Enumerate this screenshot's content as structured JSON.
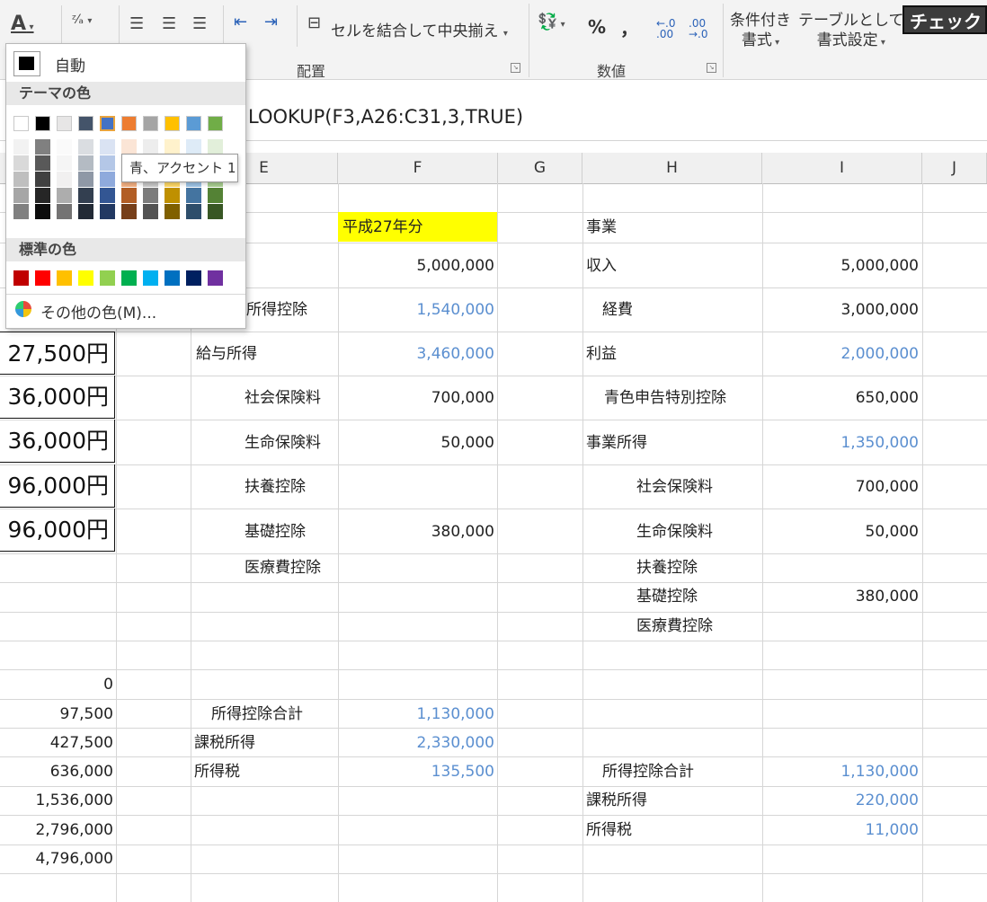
{
  "ribbon": {
    "font_color_icon": "A",
    "align_group_label": "配置",
    "number_group_label": "数値",
    "merge_center_label": "セルを結合して中央揃え",
    "percent_label": "%",
    "comma_label": "，",
    "decrease_decimal_label": "←.0 .00",
    "increase_decimal_label": ".00 →.0",
    "conditional_format_line1": "条件付き",
    "conditional_format_line2": "書式",
    "table_format_line1": "テーブルとして",
    "table_format_line2": "書式設定",
    "cell_style_label": "チェック"
  },
  "formula_bar": {
    "formula": "LOOKUP(F3,A26:C31,3,TRUE)"
  },
  "columns": [
    "E",
    "F",
    "G",
    "H",
    "I",
    "J"
  ],
  "dropdown": {
    "auto_label": "自動",
    "theme_colors_label": "テーマの色",
    "standard_colors_label": "標準の色",
    "more_colors_label": "その他の色(M)...",
    "tooltip": "青、アクセント 1",
    "theme_colors": [
      "#ffffff",
      "#000000",
      "#e7e6e6",
      "#44546a",
      "#4472c4",
      "#ed7d31",
      "#a5a5a5",
      "#ffc000",
      "#5b9bd5",
      "#70ad47"
    ],
    "standard_colors": [
      "#c00000",
      "#ff0000",
      "#ffc000",
      "#ffff00",
      "#92d050",
      "#00b050",
      "#00b0f0",
      "#0070c0",
      "#002060",
      "#7030a0"
    ]
  },
  "left_yen": [
    "27,500円",
    "36,000円",
    "36,000円",
    "96,000円",
    "96,000円"
  ],
  "left_numbers": [
    "0",
    "97,500",
    "427,500",
    "636,000",
    "1,536,000",
    "2,796,000",
    "4,796,000"
  ],
  "cells": {
    "heisei": "平成27年分",
    "f_income": "5,000,000",
    "e_shotoku_kojo": "所得控除",
    "f_shotoku_kojo": "1,540,000",
    "e_kyuyo": "給与所得",
    "f_kyuyo": "3,460,000",
    "e_shakai": "社会保険料",
    "f_shakai": "700,000",
    "e_seimei": "生命保険料",
    "f_seimei": "50,000",
    "e_fuyo": "扶養控除",
    "e_kiso": "基礎控除",
    "f_kiso": "380,000",
    "e_iryo": "医療費控除",
    "e_gokei": "所得控除合計",
    "f_gokei": "1,130,000",
    "e_kazei": "課税所得",
    "f_kazei": "2,330,000",
    "e_shotokuzei": "所得税",
    "f_shotokuzei": "135,500",
    "h_jigyo": "事業",
    "h_shunyu": "収入",
    "i_shunyu": "5,000,000",
    "h_keihi": "経費",
    "i_keihi": "3,000,000",
    "h_rieki": "利益",
    "i_rieki": "2,000,000",
    "h_aoiro": "青色申告特別控除",
    "i_aoiro": "650,000",
    "h_jigyo_shotoku": "事業所得",
    "i_jigyo_shotoku": "1,350,000",
    "h_shakai": "社会保険料",
    "i_shakai": "700,000",
    "h_seimei": "生命保険料",
    "i_seimei": "50,000",
    "h_fuyo": "扶養控除",
    "h_kiso": "基礎控除",
    "i_kiso": "380,000",
    "h_iryo": "医療費控除",
    "h_gokei": "所得控除合計",
    "i_gokei": "1,130,000",
    "h_kazei": "課税所得",
    "i_kazei": "220,000",
    "h_shotokuzei": "所得税",
    "i_shotokuzei": "11,000"
  }
}
